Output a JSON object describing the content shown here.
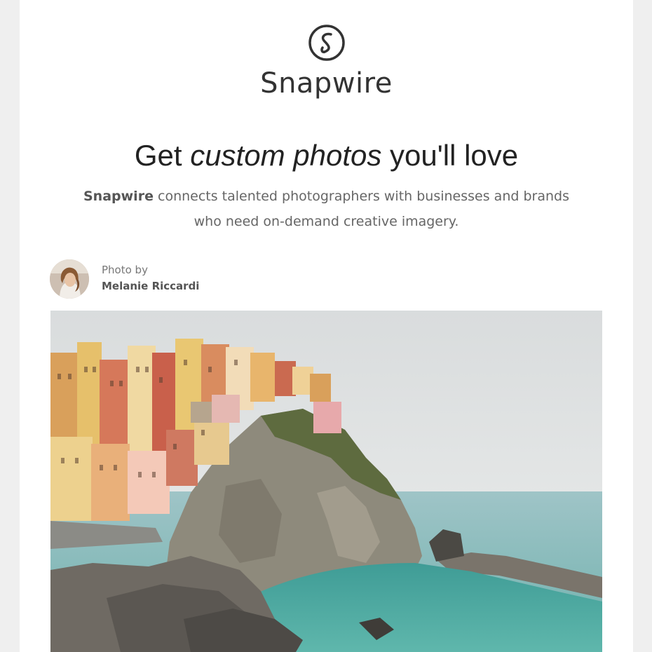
{
  "brand": {
    "name": "Snapwire",
    "icon": "snapwire-s-logo-icon"
  },
  "hero": {
    "headline_pre": "Get ",
    "headline_em": "custom photos",
    "headline_post": " you'll love",
    "sub_brand": "Snapwire",
    "sub_line1": " connects talented photographers with businesses and brands",
    "sub_line2": "who need on-demand creative imagery."
  },
  "credit": {
    "label": "Photo by",
    "name": "Melanie Riccardi"
  },
  "colors": {
    "page_bg": "#efefef",
    "card_bg": "#ffffff",
    "text_dark": "#222222",
    "text_muted": "#666666"
  }
}
